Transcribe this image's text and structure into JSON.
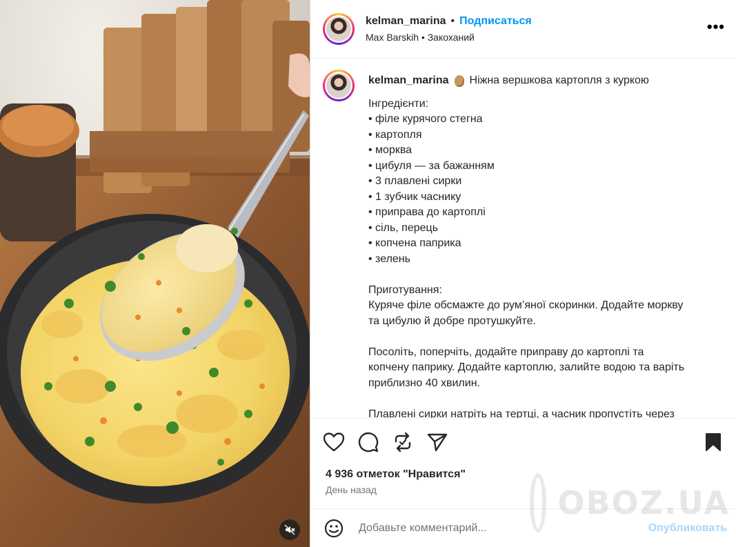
{
  "header": {
    "username": "kelman_marina",
    "separator": "•",
    "follow_label": "Подписаться",
    "audio": "Max Barskih • Закоханий",
    "more_label": "•••"
  },
  "caption": {
    "username": "kelman_marina",
    "emoji_icon": "potato-icon",
    "title": "Ніжна вершкова картопля з куркою",
    "lines": [
      "Інгредієнти:",
      "• філе курячого стегна",
      "• картопля",
      "• морква",
      "• цибуля — за бажанням",
      "• 3 плавлені сирки",
      "• 1 зубчик часнику",
      "• приправа до картоплі",
      "• сіль, перець",
      "• копчена паприка",
      "• зелень",
      "",
      "Приготування:",
      "Куряче філе обсмажте до рум’яної скоринки. Додайте моркву",
      "та цибулю й добре протушкуйте.",
      "",
      "Посоліть, поперчіть, додайте приправу до картоплі та",
      "копчену паприку. Додайте картоплю, залийте водою та варіть",
      "приблизно 40 хвилин.",
      "",
      "Плавлені сирки натріть на тертці, а часник пропустіть через"
    ]
  },
  "actions": {
    "like_icon": "heart-icon",
    "comment_icon": "comment-icon",
    "repost_icon": "repost-icon",
    "share_icon": "send-icon",
    "save_icon": "bookmark-icon",
    "likes_text": "4 936 отметок \"Нравится\"",
    "time_text": "День назад"
  },
  "comment": {
    "placeholder": "Добавьте комментарий...",
    "publish_label": "Опубликовать"
  },
  "watermark": {
    "text": "OBOZ.UA"
  },
  "colors": {
    "accent": "#0095f6",
    "publish_disabled": "#a8d6fb",
    "muted": "#737373"
  }
}
